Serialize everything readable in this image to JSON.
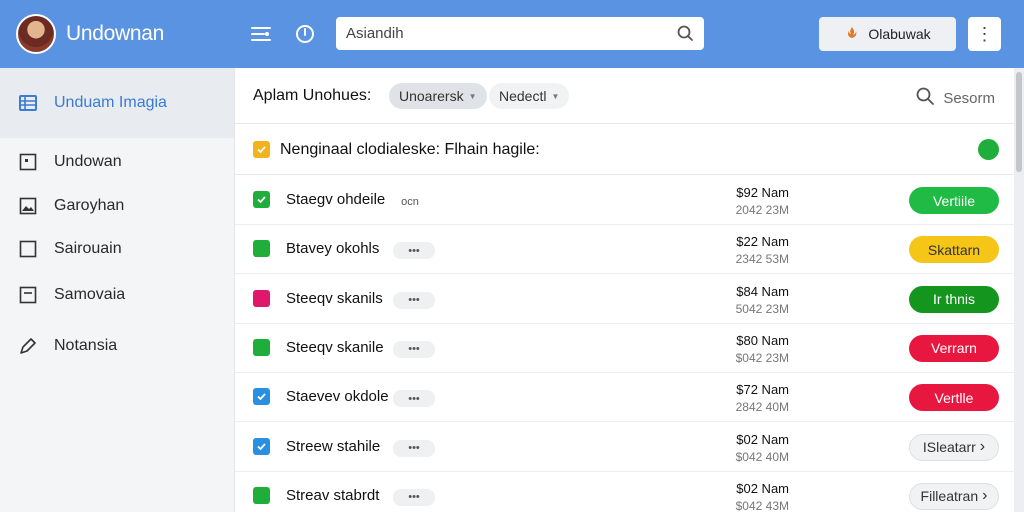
{
  "header": {
    "app_title": "Undownan",
    "search_value": "Asiandih",
    "main_button_label": "Olabuwak",
    "more_label": "⋮"
  },
  "sidebar": {
    "items": [
      {
        "label": "Unduam Imagia",
        "icon": "list-icon",
        "active": true
      },
      {
        "label": "Undowan",
        "icon": "square-dot-icon"
      },
      {
        "label": "Garoyhan",
        "icon": "image-icon"
      },
      {
        "label": "Sairouain",
        "icon": "square-icon"
      },
      {
        "label": "Samovaia",
        "icon": "minus-square-icon"
      },
      {
        "label": "Notansia",
        "icon": "pen-icon"
      }
    ]
  },
  "toolbar": {
    "label": "Aplam Unohues:",
    "chip_1": "Unoarersk",
    "chip_2": "Nedectl",
    "search_label": "Sesorm"
  },
  "group": {
    "label": "Nenginaal clodialeske: Flhain hagile:",
    "dot_color": "#1fae3c"
  },
  "rows": [
    {
      "name": "Staegv ohdeile",
      "tag": "ocn",
      "amount": "$92 Nam",
      "sub": "2042 23M",
      "status": "Vertiile",
      "status_color": "#1fbb45",
      "check_color": "#1fae3c",
      "checked": true
    },
    {
      "name": "Btavey okohls",
      "tag": "•••",
      "amount": "$22 Nam",
      "sub": "2342 53M",
      "status": "Skattarn",
      "status_color": "#f5c518",
      "check_color": "#1fae3c",
      "checked": false
    },
    {
      "name": "Steeqv skanils",
      "tag": "•••",
      "amount": "$84 Nam",
      "sub": "5042 23M",
      "status": "Ir thnis",
      "status_color": "#14961e",
      "check_color": "#e0186c",
      "checked": false
    },
    {
      "name": "Steeqv skanile",
      "tag": "•••",
      "amount": "$80 Nam",
      "sub": "$042 23M",
      "status": "Verrarn",
      "status_color": "#e8173f",
      "check_color": "#1fae3c",
      "checked": false
    },
    {
      "name": "Staevev okdole",
      "tag": "•••",
      "amount": "$72 Nam",
      "sub": "2842 40M",
      "status": "Vertlle",
      "status_color": "#e8173f",
      "check_color": "#2a8fe0",
      "checked": true
    },
    {
      "name": "Streew stahile",
      "tag": "•••",
      "amount": "$02 Nam",
      "sub": "$042 40M",
      "status": "ISleatarr",
      "status_color": "outline",
      "check_color": "#2a8fe0",
      "checked": true
    },
    {
      "name": "Streav stabrdt",
      "tag": "•••",
      "amount": "$02 Nam",
      "sub": "$042 43M",
      "status": "Filleatran",
      "status_color": "outline",
      "check_color": "#1fae3c",
      "checked": false
    }
  ]
}
